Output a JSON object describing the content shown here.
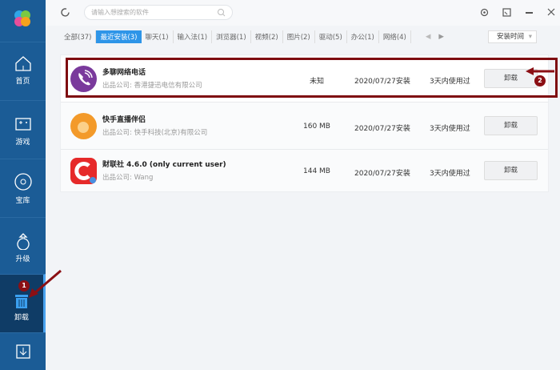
{
  "sidebar": {
    "items": [
      {
        "label": "首页",
        "icon": "home-icon"
      },
      {
        "label": "游戏",
        "icon": "gamepad-icon"
      },
      {
        "label": "宝库",
        "icon": "disc-icon"
      },
      {
        "label": "升级",
        "icon": "upgrade-icon"
      },
      {
        "label": "卸载",
        "icon": "trash-icon",
        "badge": "1"
      }
    ]
  },
  "search": {
    "placeholder": "请输入想搜索的软件"
  },
  "tabs": [
    "全部(37)",
    "最近安装(3)",
    "聊天(1)",
    "输入法(1)",
    "浏览器(1)",
    "视频(2)",
    "图片(2)",
    "驱动(5)",
    "办公(1)",
    "网络(4)"
  ],
  "sort": {
    "value": "安装时间"
  },
  "apps": [
    {
      "name": "多聊网络电话",
      "publisher": "出品公司: 香港捷迅电信有限公司",
      "size": "未知",
      "date": "2020/07/27安装",
      "used": "3天内使用过",
      "button": "卸载",
      "color": "#7a3a9c"
    },
    {
      "name": "快手直播伴侣",
      "publisher": "出品公司: 快手科技(北京)有限公司",
      "size": "160 MB",
      "date": "2020/07/27安装",
      "used": "3天内使用过",
      "button": "卸载",
      "color": "#f39a2a"
    },
    {
      "name": "财联社 4.6.0 (only current user)",
      "publisher": "出品公司: Wang",
      "size": "144 MB",
      "date": "2020/07/27安装",
      "used": "3天内使用过",
      "button": "卸载",
      "color": "#e62a2a"
    }
  ],
  "annotation": {
    "badge2": "2"
  }
}
